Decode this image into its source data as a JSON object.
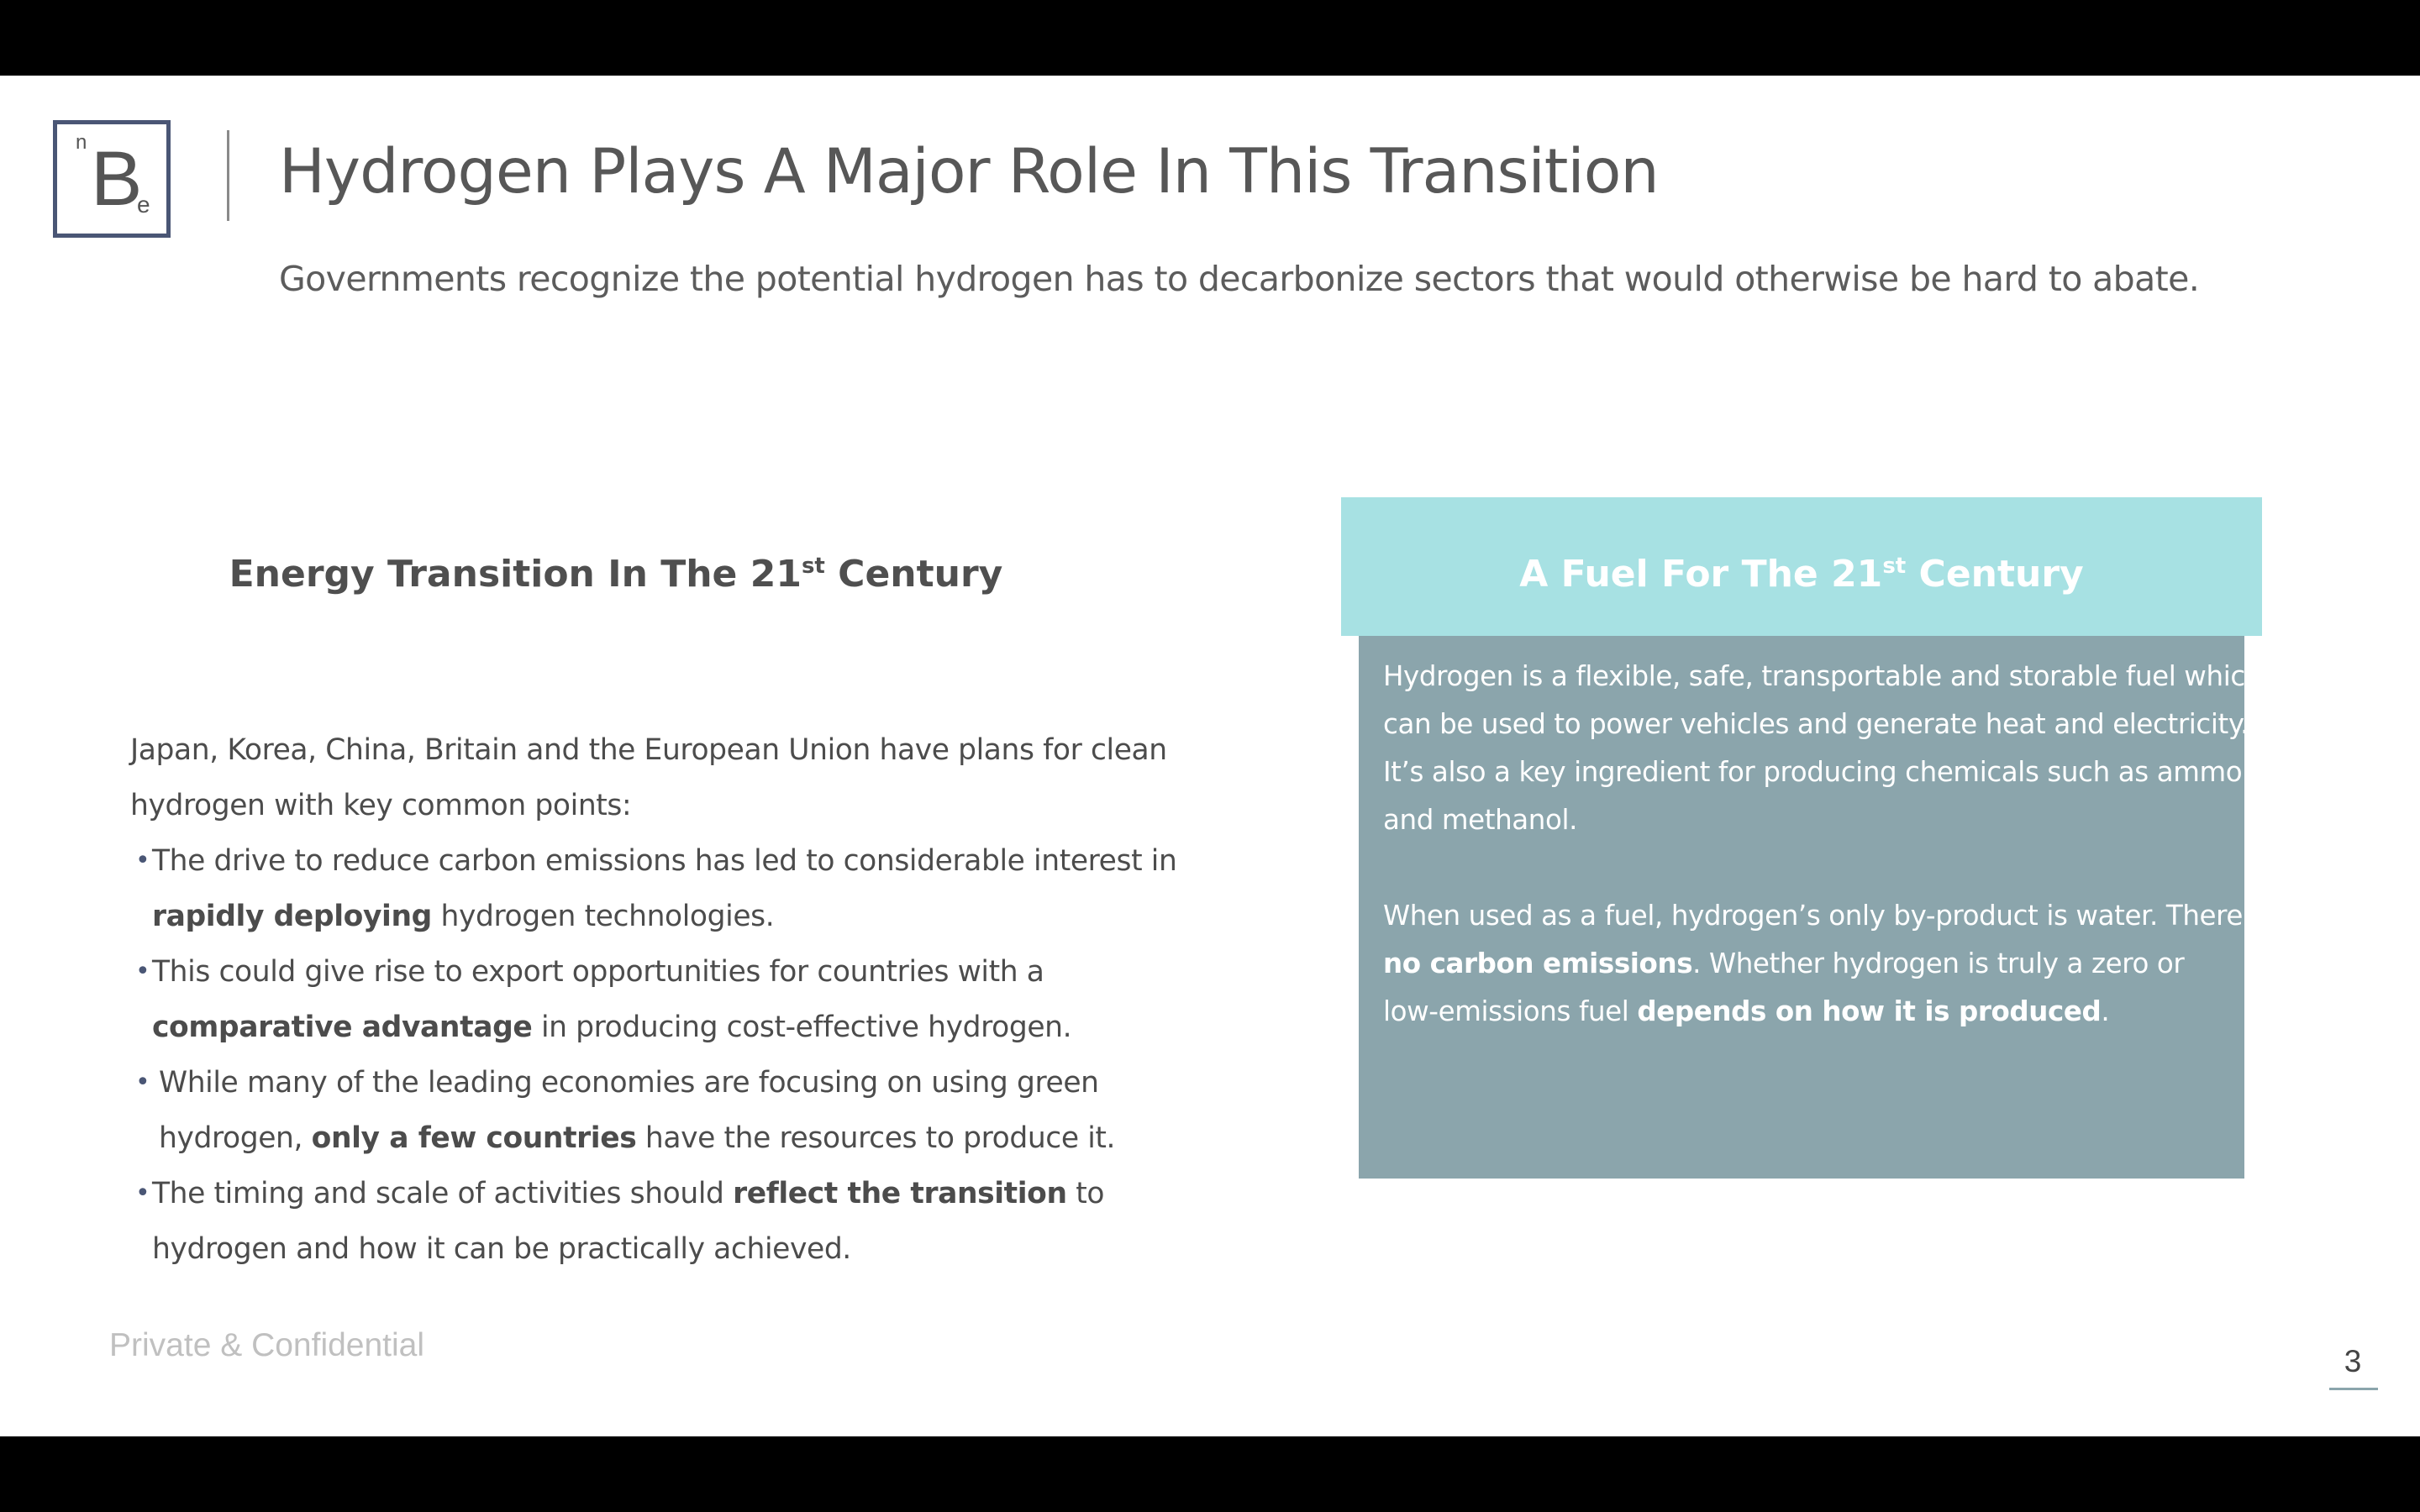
{
  "logo": {
    "superscript": "n",
    "letter": "B",
    "subscript": "e"
  },
  "header": {
    "title": "Hydrogen Plays A Major Role In This Transition",
    "subtitle": "Governments recognize the potential hydrogen has to decarbonize sectors that would otherwise be hard to abate."
  },
  "left": {
    "heading_main": "Energy Transition In The 21",
    "heading_sup": "st",
    "heading_end": " Century",
    "intro_line1": "Japan, Korea, China, Britain and the European Union have plans for clean",
    "intro_line2": "hydrogen with key common points:",
    "bullet_symbol": "•",
    "bullets": [
      {
        "line1": "The drive to reduce carbon emissions has led to considerable interest in",
        "line2_bold": "rapidly deploying",
        "line2_rest": " hydrogen technologies."
      },
      {
        "line1": "This could give rise to export opportunities for countries with a",
        "line2_bold": "comparative advantage",
        "line2_rest": " in producing cost-effective hydrogen."
      },
      {
        "line1": "While many of the leading economies are focusing on using green",
        "line2_pre": "hydrogen, ",
        "line2_bold": "only a few countries",
        "line2_rest": " have the resources to produce it."
      },
      {
        "line1_pre": "The timing and scale of activities should ",
        "line1_bold": "reflect the transition",
        "line1_rest": " to",
        "line2": "hydrogen and how it can be practically achieved."
      }
    ]
  },
  "right": {
    "heading_main": "A Fuel For The 21",
    "heading_sup": "st",
    "heading_end": " Century",
    "para1": [
      "Hydrogen is a flexible, safe, transportable and storable fuel which",
      "can be used to power vehicles and generate heat and electricity.",
      "It’s also a key ingredient for producing chemicals such as ammonia",
      "and methanol."
    ],
    "para2_line1": "When used as a fuel, hydrogen’s only by-product is water. There are",
    "para2_line2_bold": "no carbon emissions",
    "para2_line2_rest": ". Whether hydrogen is truly a zero or",
    "para2_line3_pre": "low-emissions fuel ",
    "para2_line3_bold": "depends on how it is produced",
    "para2_line3_rest": "."
  },
  "footer": {
    "confidential": "Private & Confidential",
    "page_number": "3"
  },
  "colors": {
    "logo_border": "#4a5675",
    "fuel_header_bg": "#a7e1e3",
    "fuel_body_bg": "#8ba5ac",
    "frame": "#000000"
  }
}
